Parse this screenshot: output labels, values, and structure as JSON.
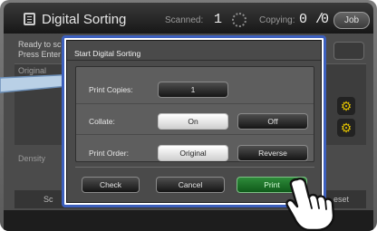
{
  "topbar": {
    "mode_title": "Digital Sorting",
    "scanned_label": "Scanned:",
    "scanned_value": "1",
    "copying_label": "Copying:",
    "copying_value": "0 /",
    "copying_total": "0",
    "job_button": "Job",
    "mode_icon": "document-icon",
    "status_icon": "gear-icon"
  },
  "background": {
    "ready_line1": "Ready to sc",
    "ready_line2": "Press Enter",
    "original_label": "Original",
    "density_label": "Density",
    "bottom_left": "Sc",
    "bottom_right": "eset",
    "sort_icon": "sort-icon"
  },
  "dialog": {
    "title": "Start Digital Sorting",
    "rows": {
      "print_copies": {
        "label": "Print Copies:",
        "value": "1"
      },
      "collate": {
        "label": "Collate:",
        "on": "On",
        "off": "Off",
        "selected": "On"
      },
      "print_order": {
        "label": "Print Order:",
        "original": "Original",
        "reverse": "Reverse",
        "selected": "Original"
      }
    },
    "buttons": {
      "check": "Check",
      "cancel": "Cancel",
      "print": "Print"
    }
  },
  "colors": {
    "dialog_border": "#3c5fbd",
    "print_button": "#1f7a2c",
    "selected_button": "#f2f2f2",
    "panel": "#5e5e5e"
  },
  "icons": {
    "pointer": "hand-pointer-icon",
    "callout": "callout-arrow-icon"
  }
}
